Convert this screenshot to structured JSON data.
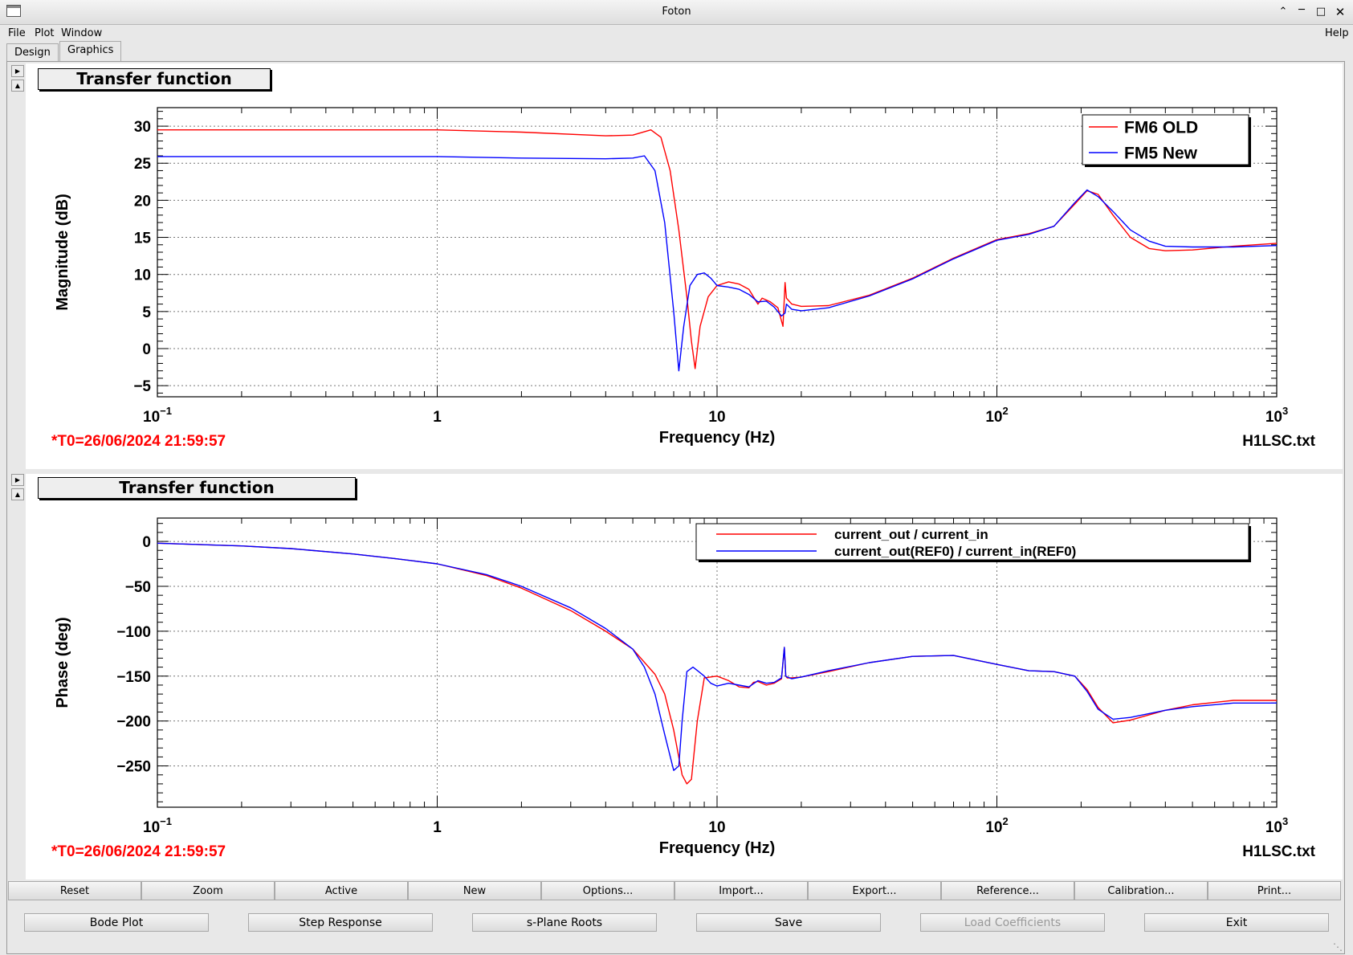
{
  "window": {
    "title": "Foton"
  },
  "menu": {
    "file": "File",
    "plot": "Plot",
    "window": "Window",
    "help": "Help"
  },
  "tabs": [
    {
      "label": "Design"
    },
    {
      "label": "Graphics"
    }
  ],
  "plots": [
    {
      "title_box": "Transfer function",
      "timestamp": "*T0=26/06/2024 21:59:57",
      "filename": "H1LSC.txt",
      "chart_data": {
        "type": "line",
        "xlabel": "Frequency (Hz)",
        "ylabel": "Magnitude (dB)",
        "xscale": "log",
        "xlim": [
          0.1,
          1000
        ],
        "ylim": [
          -6.5,
          32.5
        ],
        "yticks": [
          30,
          25,
          20,
          15,
          10,
          5,
          0,
          -5
        ],
        "xtick_labels": [
          "10^-1",
          "1",
          "10",
          "10^2",
          "10^3"
        ],
        "grid": true,
        "legend_position": "top-right",
        "series": [
          {
            "name": "FM6 OLD",
            "color": "#ff0000",
            "x": [
              0.1,
              0.3,
              1,
              2,
              4,
              5,
              5.8,
              6.3,
              6.8,
              7.3,
              7.8,
              8.1,
              8.35,
              8.7,
              9.3,
              10,
              11,
              12,
              13,
              14,
              14.5,
              15.5,
              16.5,
              17.2,
              17.5,
              17.7,
              18.5,
              20,
              25,
              35,
              50,
              70,
              100,
              130,
              160,
              190,
              210,
              230,
              260,
              300,
              350,
              400,
              500,
              700,
              1000
            ],
            "y": [
              29.5,
              29.5,
              29.5,
              29.2,
              28.7,
              28.8,
              29.5,
              28.5,
              24,
              16,
              7,
              1,
              -2.7,
              3,
              7,
              8.5,
              9,
              8.7,
              8,
              6,
              6.8,
              6.3,
              5.5,
              3,
              8.9,
              6.8,
              6,
              5.7,
              5.8,
              7.2,
              9.5,
              12.2,
              14.7,
              15.5,
              16.5,
              19.5,
              21.3,
              20.8,
              18,
              15,
              13.5,
              13.2,
              13.3,
              13.8,
              14.2
            ]
          },
          {
            "name": "FM5 New",
            "color": "#0000ff",
            "x": [
              0.1,
              0.3,
              1,
              2,
              4,
              5,
              5.5,
              6,
              6.5,
              7,
              7.3,
              7.6,
              8,
              8.5,
              9,
              9.5,
              10,
              11,
              12,
              13,
              14,
              15,
              16,
              17,
              17.5,
              17.7,
              18.5,
              20,
              25,
              35,
              50,
              70,
              100,
              130,
              160,
              190,
              210,
              230,
              260,
              300,
              350,
              400,
              500,
              700,
              1000
            ],
            "y": [
              25.9,
              25.9,
              25.9,
              25.7,
              25.6,
              25.7,
              26,
              24,
              17,
              5,
              -3,
              3,
              8.5,
              10,
              10.2,
              9.5,
              8.5,
              8.3,
              8,
              7.3,
              6.3,
              6.4,
              5.6,
              4.4,
              4.8,
              6,
              5.3,
              5.1,
              5.5,
              7.1,
              9.4,
              12.1,
              14.6,
              15.4,
              16.5,
              19.7,
              21.4,
              20.5,
              18.5,
              16,
              14.5,
              13.8,
              13.7,
              13.7,
              13.9
            ]
          }
        ]
      }
    },
    {
      "title_box": "Transfer function",
      "timestamp": "*T0=26/06/2024 21:59:57",
      "filename": "H1LSC.txt",
      "chart_data": {
        "type": "line",
        "xlabel": "Frequency (Hz)",
        "ylabel": "Phase (deg)",
        "xscale": "log",
        "xlim": [
          0.1,
          1000
        ],
        "ylim": [
          -296,
          26
        ],
        "yticks": [
          0,
          -50,
          -100,
          -150,
          -200,
          -250
        ],
        "xtick_labels": [
          "10^-1",
          "1",
          "10",
          "10^2",
          "10^3"
        ],
        "grid": true,
        "legend_position": "top-right",
        "series": [
          {
            "name": "current_out / current_in",
            "color": "#ff0000",
            "x": [
              0.1,
              0.2,
              0.3,
              0.5,
              0.7,
              1,
              1.5,
              2,
              3,
              4,
              5,
              6,
              6.5,
              7,
              7.5,
              7.8,
              8.1,
              8.5,
              9,
              10,
              11,
              12,
              13,
              13.5,
              14,
              15,
              16,
              17,
              17.4,
              17.6,
              17.8,
              18.5,
              20,
              25,
              35,
              50,
              70,
              100,
              130,
              160,
              190,
              210,
              230,
              260,
              300,
              400,
              500,
              700,
              1000
            ],
            "y": [
              -2,
              -5,
              -8,
              -14,
              -19,
              -25,
              -38,
              -52,
              -77,
              -100,
              -120,
              -148,
              -170,
              -210,
              -260,
              -270,
              -265,
              -200,
              -152,
              -150,
              -155,
              -162,
              -163,
              -157,
              -156,
              -160,
              -158,
              -153,
              -118,
              -150,
              -152,
              -152,
              -151,
              -145,
              -135,
              -128,
              -127,
              -137,
              -144,
              -145,
              -150,
              -165,
              -185,
              -202,
              -199,
              -188,
              -182,
              -177,
              -177
            ]
          },
          {
            "name": "current_out(REF0) / current_in(REF0)",
            "color": "#0000ff",
            "x": [
              0.1,
              0.2,
              0.3,
              0.5,
              0.7,
              1,
              1.5,
              2,
              3,
              4,
              5,
              5.5,
              6,
              6.5,
              7,
              7.3,
              7.5,
              7.8,
              8.2,
              8.6,
              9,
              9.5,
              10,
              11,
              12,
              13,
              14,
              15,
              16,
              17,
              17.4,
              17.6,
              17.8,
              18.5,
              20,
              25,
              35,
              50,
              70,
              100,
              130,
              160,
              190,
              210,
              230,
              260,
              300,
              400,
              500,
              700,
              1000
            ],
            "y": [
              -2,
              -5,
              -8,
              -14,
              -19,
              -25,
              -37,
              -50,
              -74,
              -97,
              -120,
              -140,
              -170,
              -215,
              -255,
              -250,
              -200,
              -145,
              -140,
              -145,
              -150,
              -158,
              -161,
              -158,
              -160,
              -162,
              -155,
              -158,
              -157,
              -152,
              -118,
              -150,
              -151,
              -153,
              -151,
              -144,
              -135,
              -128,
              -127,
              -137,
              -144,
              -145,
              -150,
              -167,
              -187,
              -198,
              -196,
              -188,
              -184,
              -180,
              -180
            ]
          }
        ]
      }
    }
  ],
  "toolbar": [
    "Reset",
    "Zoom",
    "Active",
    "New",
    "Options...",
    "Import...",
    "Export...",
    "Reference...",
    "Calibration...",
    "Print..."
  ],
  "bottom_buttons": {
    "bode": "Bode Plot",
    "step": "Step Response",
    "splane": "s-Plane Roots",
    "save": "Save",
    "load": "Load Coefficients",
    "exit": "Exit"
  }
}
